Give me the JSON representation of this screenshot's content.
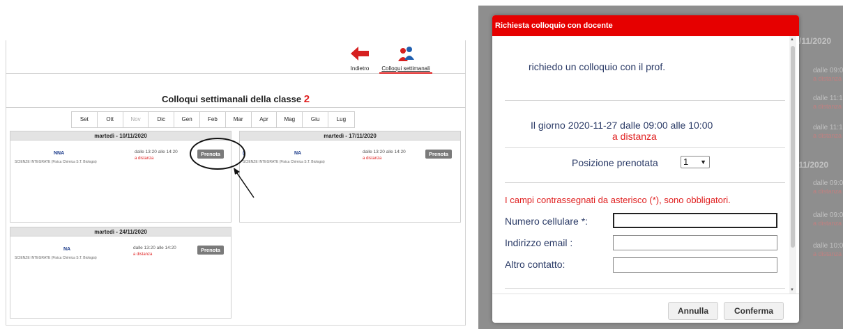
{
  "toolbar": {
    "back_label": "Indietro",
    "weekly_label": "Colloqui settimanali"
  },
  "title": {
    "text": "Colloqui settimanali della classe",
    "class_num": "2"
  },
  "months": [
    {
      "label": "Set",
      "disabled": false
    },
    {
      "label": "Ott",
      "disabled": false
    },
    {
      "label": "Nov",
      "disabled": true
    },
    {
      "label": "Dic",
      "disabled": false
    },
    {
      "label": "Gen",
      "disabled": false
    },
    {
      "label": "Feb",
      "disabled": false
    },
    {
      "label": "Mar",
      "disabled": false
    },
    {
      "label": "Apr",
      "disabled": false
    },
    {
      "label": "Mag",
      "disabled": false
    },
    {
      "label": "Giu",
      "disabled": false
    },
    {
      "label": "Lug",
      "disabled": false
    }
  ],
  "cards": [
    {
      "date": "martedì - 10/11/2020",
      "teacher": "NNA",
      "subject": "SCIENZE INTEGRATE (Fisica Chimica S.T. Biologia)",
      "time": "dalle 13:20 alle 14:20",
      "mode": "a distanza",
      "button": "Prenota"
    },
    {
      "date": "martedì - 17/11/2020",
      "teacher_prefix": "(",
      "teacher": "NA",
      "subject": "SCIENZE INTEGRATE (Fisica Chimica S.T. Biologia)",
      "time": "dalle 13:20 alle 14:20",
      "mode": "a distanza",
      "button": "Prenota"
    },
    {
      "date": "martedì - 24/11/2020",
      "teacher": "NA",
      "subject": "SCIENZE INTEGRATE (Fisica Chimica S.T. Biologia)",
      "time": "dalle 13:20 alle 14:20",
      "mode": "a distanza",
      "button": "Prenota"
    }
  ],
  "background": {
    "dates": [
      "/11/2020",
      "/11/2020"
    ],
    "times": [
      "dalle 09:00",
      "dalle 11:10",
      "dalle 11:10",
      "dalle 09:0",
      "dalle 09:00",
      "dalle 10:0"
    ],
    "modes": [
      "a distanza",
      "a distanza",
      "a distanza",
      "a distanza",
      "a distanza",
      "a distanza"
    ]
  },
  "modal": {
    "title": "Richiesta colloquio con docente",
    "intro": "richiedo un colloquio con il prof.",
    "day_line": "Il giorno 2020-11-27 dalle 09:00 alle 10:00",
    "mode": "a distanza",
    "position_label": "Posizione prenotata",
    "position_value": "1",
    "required_note": "I campi contrassegnati da asterisco (*), sono obbligatori.",
    "fields": [
      {
        "label": "Numero cellulare *:",
        "value": ""
      },
      {
        "label": "Indirizzo email :",
        "value": ""
      },
      {
        "label": "Altro contatto:",
        "value": ""
      }
    ],
    "cancel_label": "Annulla",
    "confirm_label": "Conferma"
  },
  "colors": {
    "accent_red": "#e60000",
    "text_blue": "#2a3a66",
    "overlay": "#8e8e8e"
  }
}
